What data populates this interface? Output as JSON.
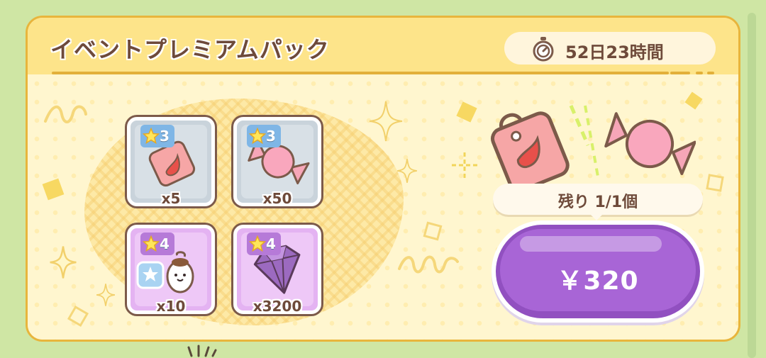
{
  "pack": {
    "title": "イベントプレミアムパック",
    "timer": {
      "icon": "stopwatch-icon",
      "text": "52日23時間"
    },
    "items": [
      {
        "name": "bag",
        "icon": "pink-bag-icon",
        "rarity": "3",
        "quantity": "x5",
        "frame": "gray"
      },
      {
        "name": "candy",
        "icon": "pink-candy-icon",
        "rarity": "3",
        "quantity": "x50",
        "frame": "gray"
      },
      {
        "name": "character",
        "icon": "character-icon",
        "rarity": "4",
        "quantity": "x10",
        "frame": "purple"
      },
      {
        "name": "gem",
        "icon": "purple-gem-icon",
        "rarity": "4",
        "quantity": "x3200",
        "frame": "purple"
      }
    ],
    "remaining": "残り 1/1個",
    "price": "￥320"
  },
  "colors": {
    "page_bg": "#cfe6a4",
    "card_border": "#e8b53c",
    "header_bg": "#fde48a",
    "title_text": "#6e4a3a",
    "buy_button": "#a865d6",
    "gray_tile": "#c9d3db",
    "purple_tile": "#e4b3f2"
  }
}
